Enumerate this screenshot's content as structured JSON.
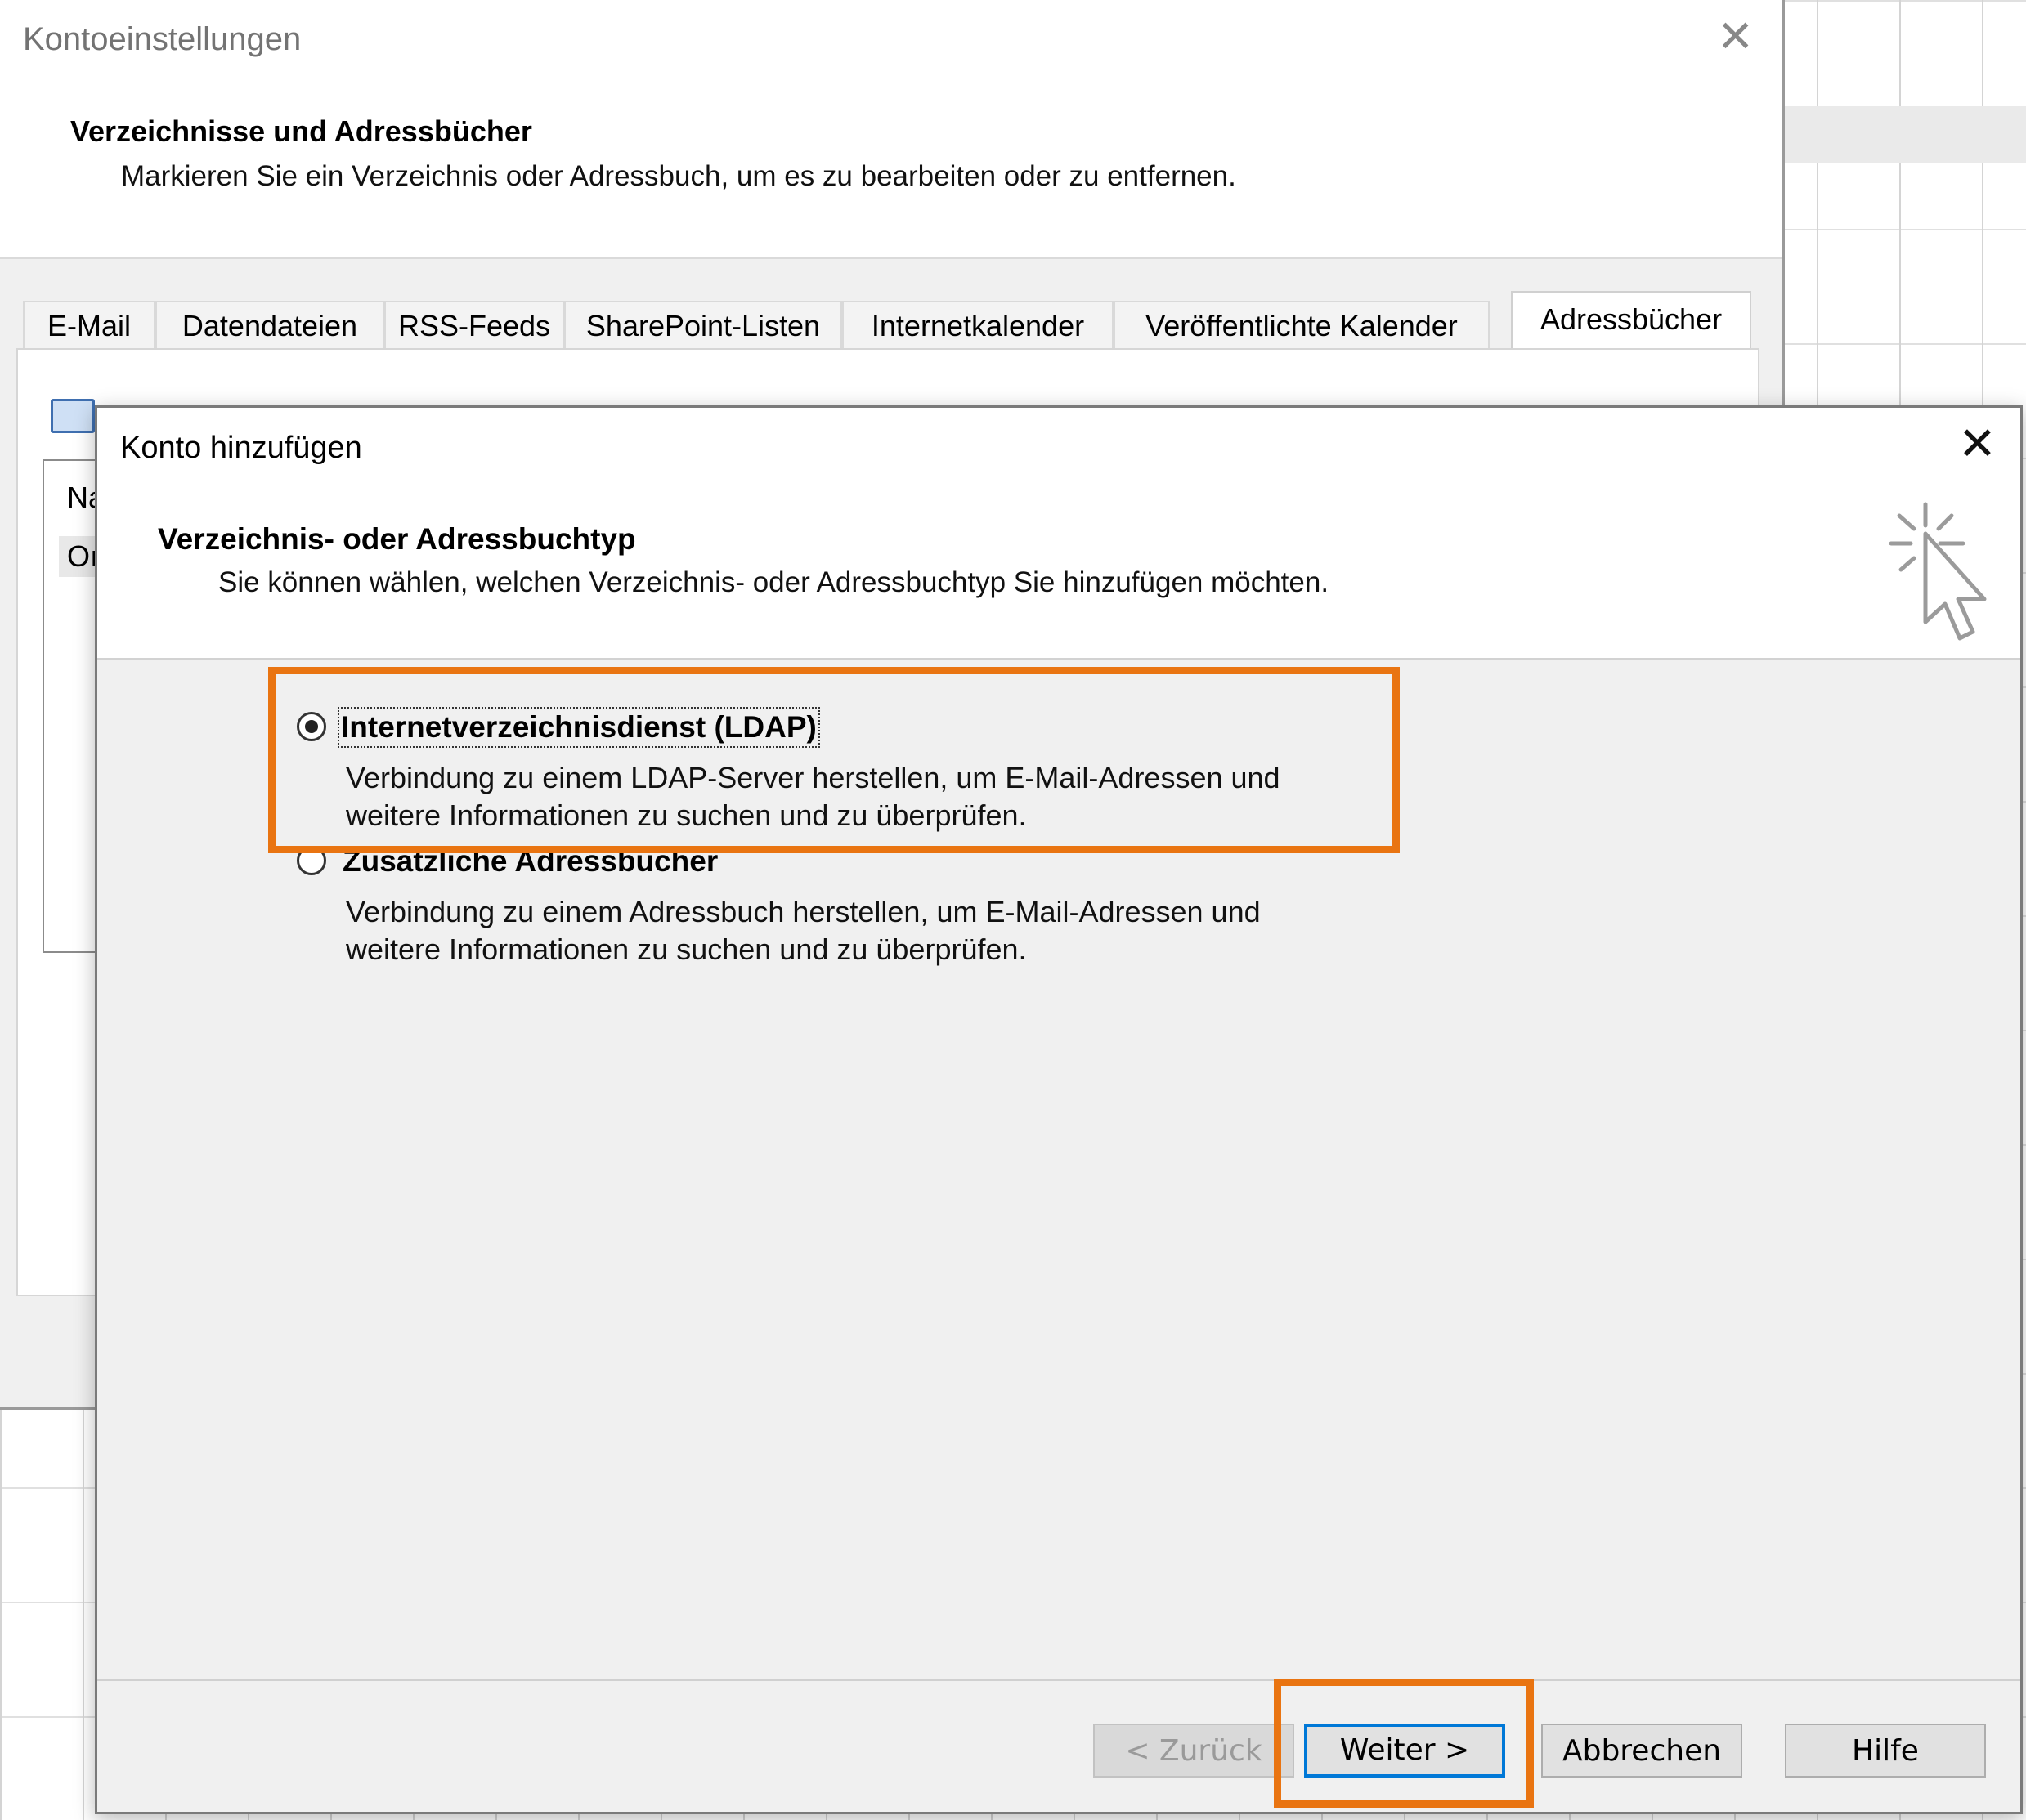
{
  "parent_window": {
    "title": "Kontoeinstellungen",
    "heading": "Verzeichnisse und Adressbücher",
    "subheading": "Markieren Sie ein Verzeichnis oder Adressbuch, um es zu bearbeiten oder zu entfernen.",
    "close_glyph": "✕",
    "tabs": [
      {
        "label": "E-Mail"
      },
      {
        "label": "Datendateien"
      },
      {
        "label": "RSS-Feeds"
      },
      {
        "label": "SharePoint-Listen"
      },
      {
        "label": "Internetkalender"
      },
      {
        "label": "Veröffentlichte Kalender"
      },
      {
        "label": "Adressbücher",
        "active": true
      }
    ],
    "list_header_fragment": "Na",
    "list_row_fragment": "Oı"
  },
  "dialog": {
    "title": "Konto hinzufügen",
    "close_glyph": "✕",
    "heading": "Verzeichnis- oder Adressbuchtyp",
    "subheading": "Sie können wählen, welchen Verzeichnis- oder Adressbuchtyp Sie hinzufügen möchten.",
    "options": [
      {
        "label": "Internetverzeichnisdienst (LDAP)",
        "description_line1": "Verbindung zu einem LDAP-Server herstellen, um E-Mail-Adressen und",
        "description_line2": "weitere Informationen zu suchen und zu überprüfen.",
        "selected": true
      },
      {
        "label": "Zusätzliche Adressbücher",
        "description_line1": "Verbindung zu einem Adressbuch herstellen, um E-Mail-Adressen und",
        "description_line2": "weitere Informationen zu suchen und zu überprüfen.",
        "selected": false
      }
    ],
    "buttons": {
      "back": "< Zurück",
      "next": "Weiter >",
      "cancel": "Abbrechen",
      "help": "Hilfe"
    }
  },
  "colors": {
    "highlight": "#e97411",
    "default_button_border": "#0078d7"
  }
}
